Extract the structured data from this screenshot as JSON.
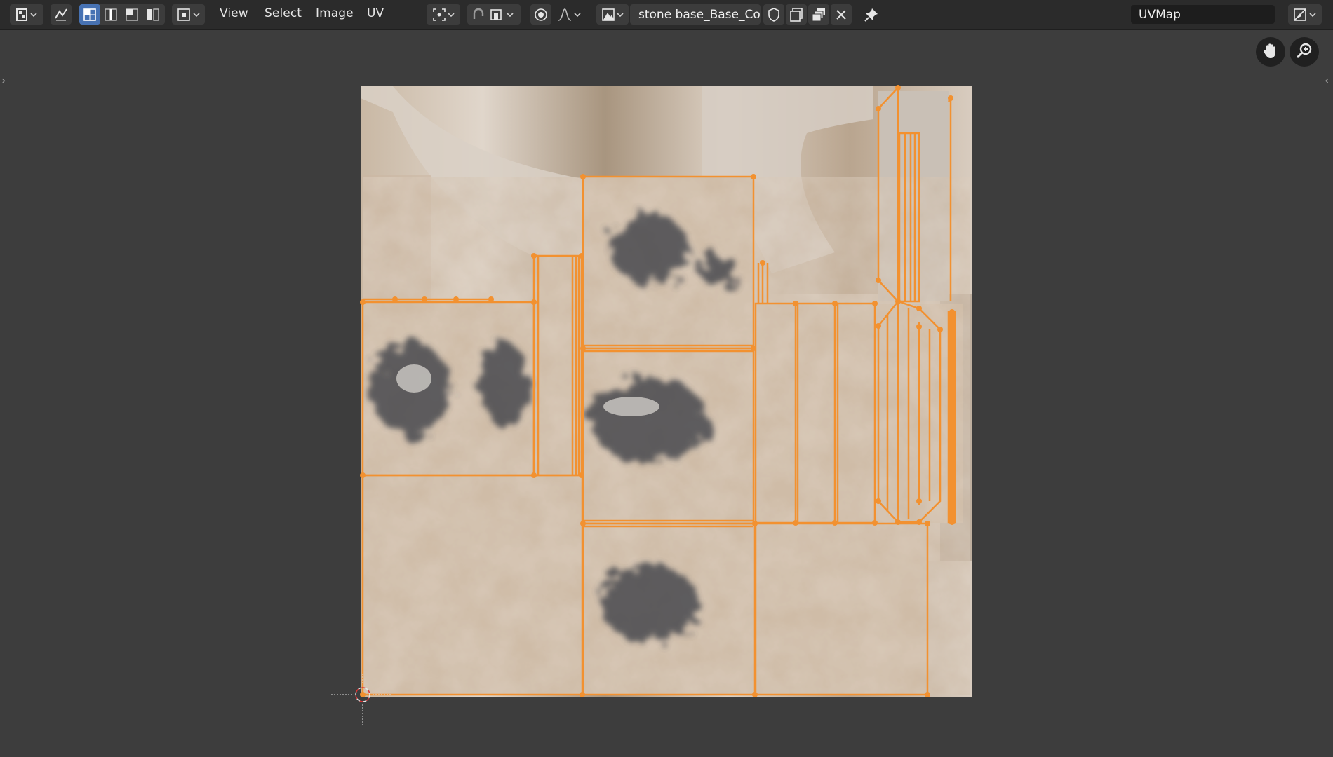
{
  "header": {
    "editor_type_icon": "uv-editor-icon",
    "menus": [
      "View",
      "Select",
      "Image",
      "UV"
    ],
    "image_name": "stone base_Base_Co..",
    "uv_map": "UVMap"
  },
  "texture_colors": {
    "background": "#d4c7b8",
    "stone_base": "#cdb69f",
    "stone_light": "#dcd2c7",
    "stone_dark": "#4a4c52",
    "uv_edge": "#f29130"
  },
  "icons": [
    "editor-type-icon",
    "sync-selection-icon",
    "vertex-select-icon",
    "edge-select-icon",
    "face-select-icon",
    "island-select-icon",
    "sticky-selection-icon",
    "pivot-icon",
    "snap-icon",
    "snap-target-icon",
    "proportional-edit-icon",
    "falloff-icon",
    "image-browse-icon",
    "fake-user-icon",
    "new-image-icon",
    "open-image-icon",
    "unlink-icon",
    "pin-icon",
    "display-mode-icon",
    "hand-pan-icon",
    "zoom-icon"
  ]
}
